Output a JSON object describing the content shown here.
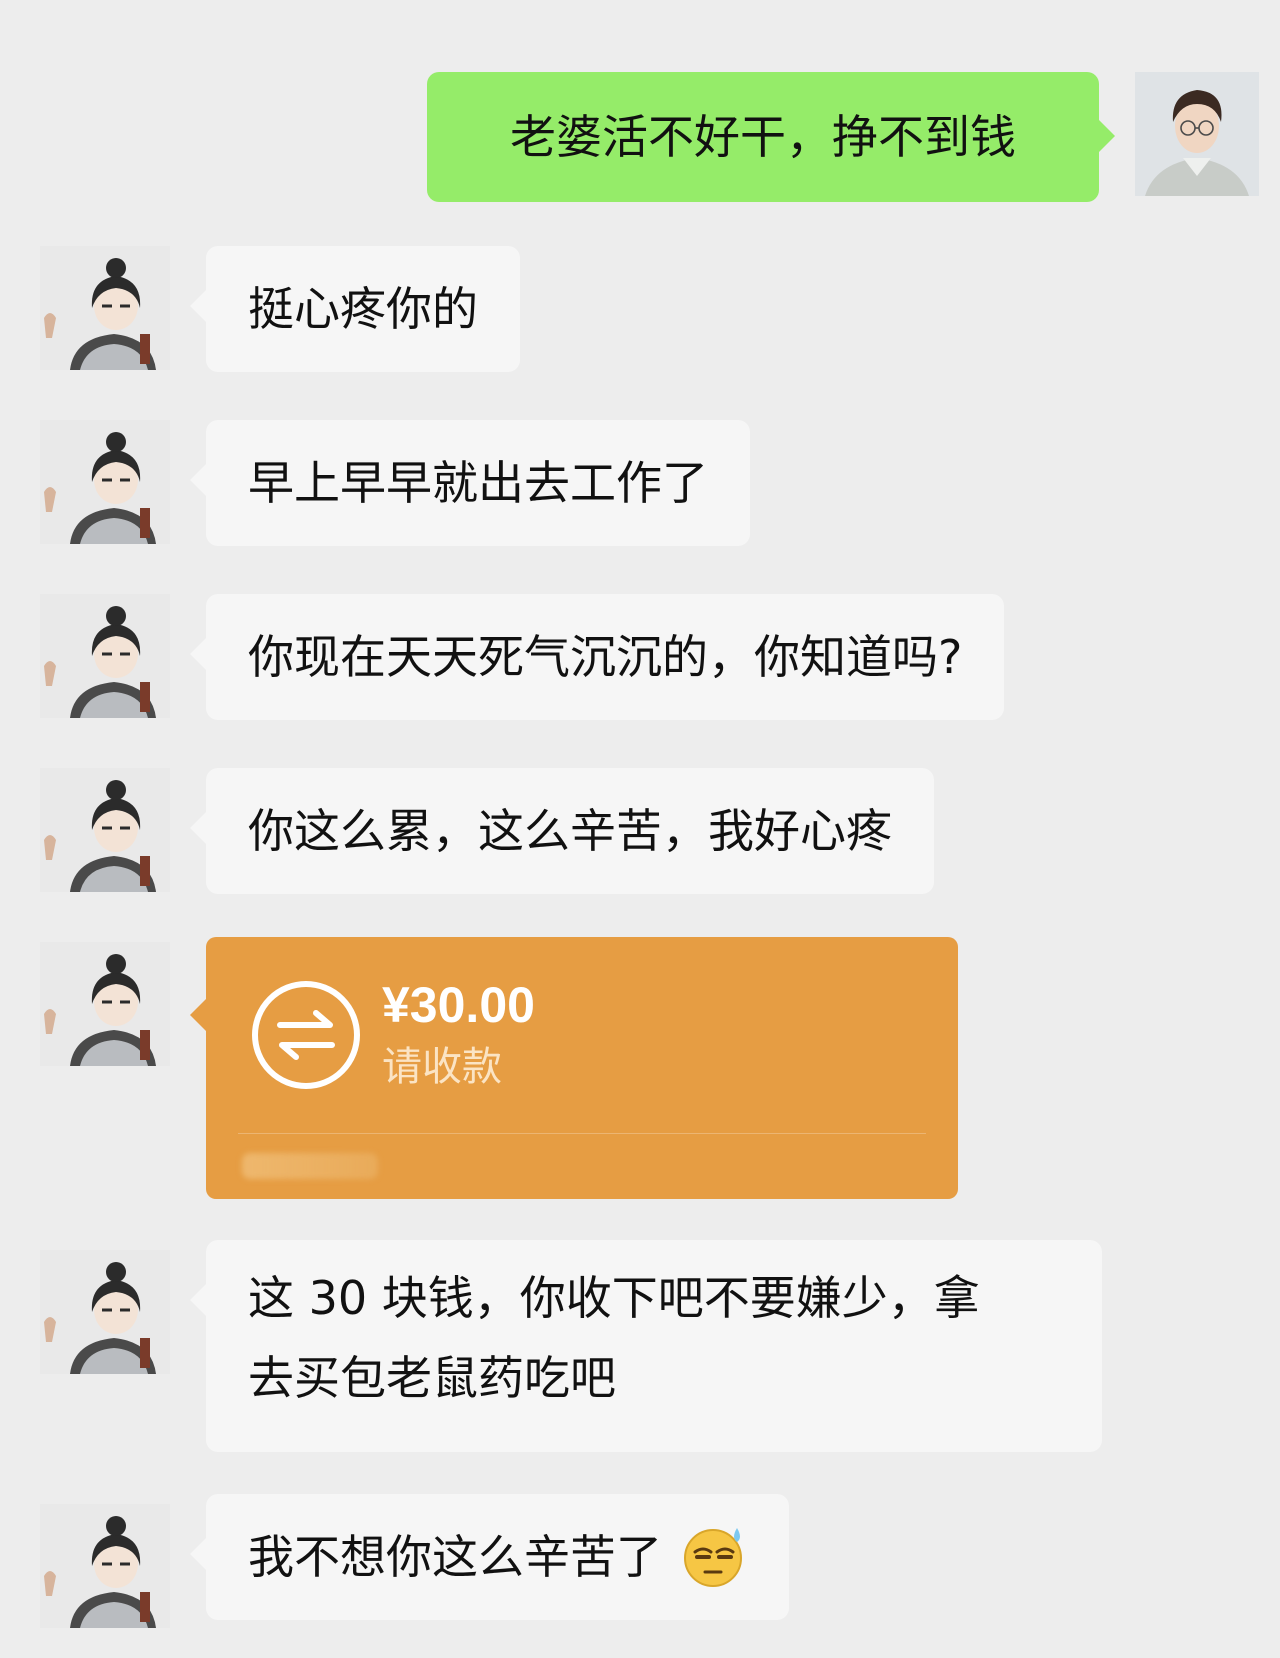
{
  "messages": [
    {
      "sender": "self",
      "text": "老婆活不好干，挣不到钱"
    },
    {
      "sender": "other",
      "text": "挺心疼你的"
    },
    {
      "sender": "other",
      "text": "早上早早就出去工作了"
    },
    {
      "sender": "other",
      "text": "你现在天天死气沉沉的，你知道吗?"
    },
    {
      "sender": "other",
      "text": "你这么累，这么辛苦，我好心疼"
    },
    {
      "sender": "other",
      "type": "transfer",
      "amount": "¥30.00",
      "status": "请收款",
      "icon": "transfer-arrows-icon"
    },
    {
      "sender": "other",
      "text_line1": "这 30 块钱，你收下吧不要嫌少，拿",
      "text_line2": "去买包老鼠药吃吧"
    },
    {
      "sender": "other",
      "text": "我不想你这么辛苦了",
      "emoji": "sweat-face-emoji"
    }
  ],
  "colors": {
    "background": "#ededed",
    "self_bubble": "#95ec69",
    "other_bubble": "#f6f6f6",
    "transfer_card": "#e69d43"
  }
}
